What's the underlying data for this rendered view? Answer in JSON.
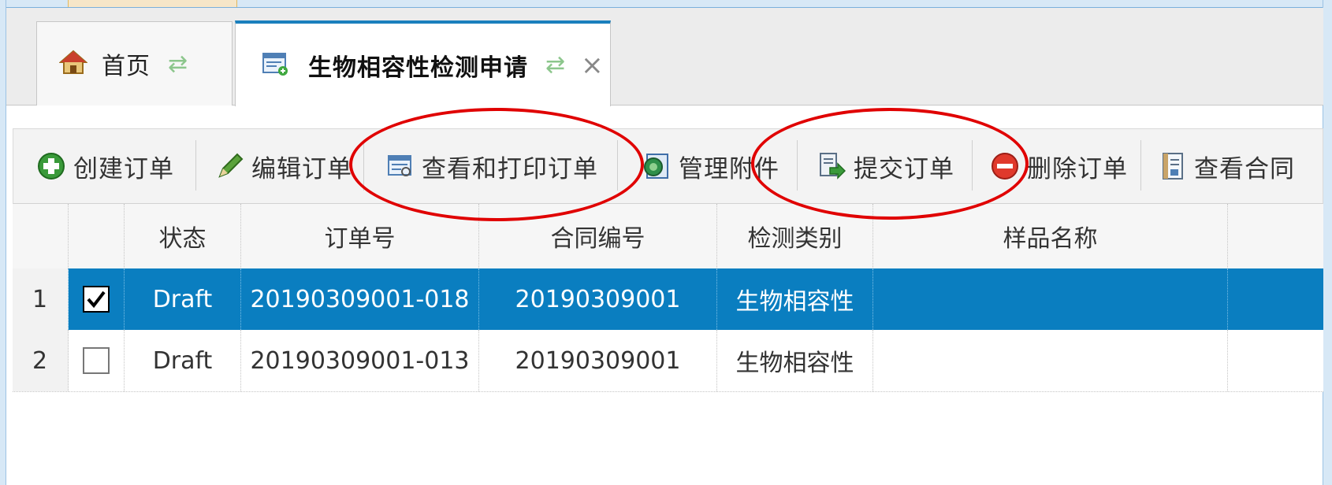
{
  "tabs": [
    {
      "label": "首页",
      "icon": "home-icon"
    },
    {
      "label": "生物相容性检测申请",
      "icon": "form-icon"
    }
  ],
  "toolbar": {
    "create_label": "创建订单",
    "edit_label": "编辑订单",
    "view_print_label": "查看和打印订单",
    "attachments_label": "管理附件",
    "submit_label": "提交订单",
    "delete_label": "删除订单",
    "contract_label": "查看合同"
  },
  "grid": {
    "columns": [
      "状态",
      "订单号",
      "合同编号",
      "检测类别",
      "样品名称"
    ],
    "rows": [
      {
        "num": "1",
        "checked": true,
        "status": "Draft",
        "order_no": "20190309001-018",
        "contract_no": "20190309001",
        "category": "生物相容性",
        "sample": ""
      },
      {
        "num": "2",
        "checked": false,
        "status": "Draft",
        "order_no": "20190309001-013",
        "contract_no": "20190309001",
        "category": "生物相容性",
        "sample": ""
      }
    ]
  },
  "colors": {
    "selected_row": "#0a7ec0",
    "tab_accent": "#1a7fbd",
    "annotation": "#e00000"
  }
}
